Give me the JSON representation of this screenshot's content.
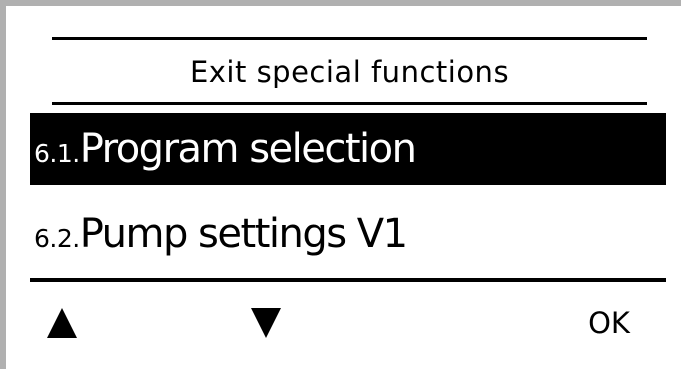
{
  "menu": {
    "header": "Exit special functions",
    "items": [
      {
        "number": "6.1.",
        "label": "Program selection",
        "selected": true
      },
      {
        "number": "6.2.",
        "label": "Pump settings V1",
        "selected": false
      }
    ]
  },
  "softkeys": {
    "up_icon": "triangle-up-icon",
    "down_icon": "triangle-down-icon",
    "ok_label": "OK"
  }
}
